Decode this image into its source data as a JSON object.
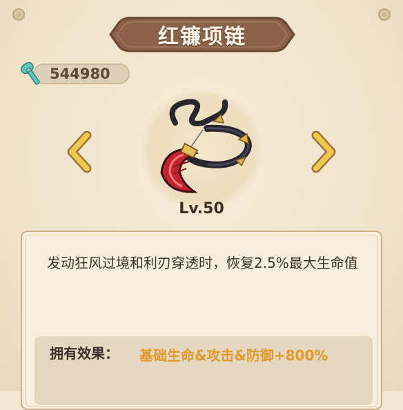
{
  "title": "红镰项链",
  "currency": {
    "icon": "wrench-icon",
    "value": "544980"
  },
  "item": {
    "icon": "red-sickle-necklace-icon",
    "level": "Lv.50"
  },
  "navigation": {
    "prev_icon": "chevron-left-icon",
    "next_icon": "chevron-right-icon"
  },
  "description": "发动狂风过境和利刃穿透时，恢复2.5%最大生命值",
  "effect": {
    "label": "拥有效果：",
    "value": "基础生命&攻击&防御+800%"
  },
  "colors": {
    "accent_gold": "#e0992a",
    "title_banner": "#8a6149",
    "arrow": "#f1c84f",
    "currency_icon": "#5bc7c0"
  }
}
